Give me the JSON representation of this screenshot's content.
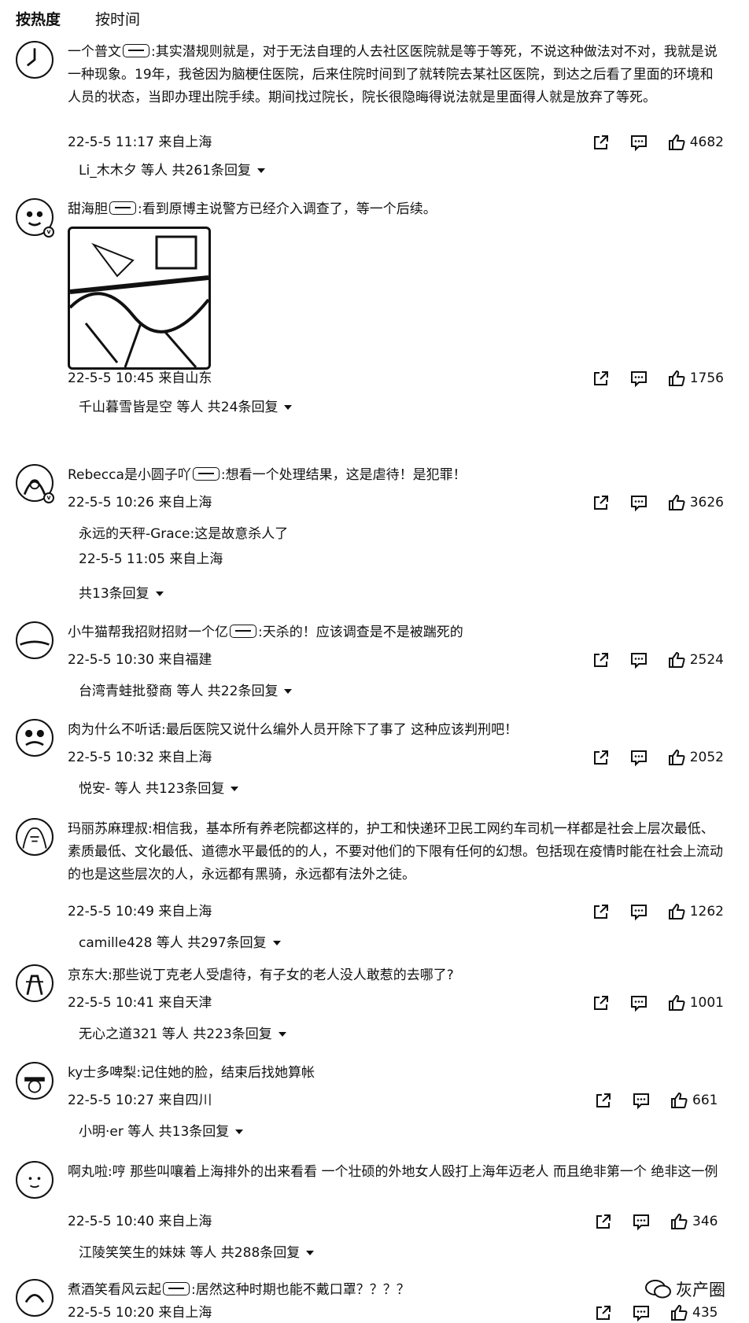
{
  "tabs": [
    {
      "label": "按热度",
      "active": true
    },
    {
      "label": "按时间",
      "active": false
    }
  ],
  "comments": [
    {
      "username": "一个普文",
      "text": ":其实潜规则就是，对于无法自理的人去社区医院就是等于等死，不说这种做法对不对，我就是说一种现象。19年，我爸因为脑梗住医院，后来住院时间到了就转院去某社区医院，到达之后看了里面的环境和人员的状态，当即办理出院手续。期间找过院长，院长很隐晦得说法就是里面得人就是放弃了等死。",
      "time": "22-5-5 11:17 来自上海",
      "likes": "4682",
      "replies": "Li_木木夕 等人  共261条回复"
    },
    {
      "username": "甜海胆",
      "text": ":看到原博主说警方已经介入调查了，等一个后续。",
      "time": "22-5-5 10:45 来自山东",
      "likes": "1756",
      "replies": "千山暮雪皆是空 等人  共24条回复"
    },
    {
      "username": "Rebecca是小圆子吖",
      "text": ":想看一个处理结果，这是虐待！是犯罪！",
      "time": "22-5-5 10:26 来自上海",
      "likes": "3626",
      "subreply": {
        "text": "永远的天秤-Grace:这是故意杀人了",
        "time": "22-5-5 11:05 来自上海"
      },
      "replies": "共13条回复"
    },
    {
      "username": "小牛猫帮我招财招财一个亿",
      "text": ":天杀的！应该调查是不是被踹死的",
      "time": "22-5-5 10:30 来自福建",
      "likes": "2524",
      "replies": "台湾青蛙批發商 等人  共22条回复"
    },
    {
      "username": "肉为什么不听话",
      "text": ":最后医院又说什么编外人员开除下了事了 这种应该判刑吧！",
      "time": "22-5-5 10:32 来自上海",
      "likes": "2052",
      "replies": "悦安- 等人  共123条回复"
    },
    {
      "username": "玛丽苏麻理叔",
      "text": ":相信我，基本所有养老院都这样的，护工和快递环卫民工网约车司机一样都是社会上层次最低、素质最低、文化最低、道德水平最低的的人，不要对他们的下限有任何的幻想。包括现在疫情时能在社会上流动的也是这些层次的人，永远都有黑骑，永远都有法外之徒。",
      "time": "22-5-5 10:49 来自上海",
      "likes": "1262",
      "replies": "camille428 等人  共297条回复"
    },
    {
      "username": "京东大",
      "text": ":那些说丁克老人受虐待，有子女的老人没人敢惹的去哪了?",
      "time": "22-5-5 10:41 来自天津",
      "likes": "1001",
      "replies": "无心之道321 等人  共223条回复"
    },
    {
      "username": "ky士多啤梨",
      "text": ":记住她的脸，结束后找她算帐",
      "time": "22-5-5 10:27 来自四川",
      "likes": "661",
      "replies": "小明·er 等人  共13条回复"
    },
    {
      "username": "啊丸啦",
      "text": ":哼 那些叫嚷着上海排外的出来看看 一个壮硕的外地女人殴打上海年迈老人 而且绝非第一个 绝非这一例",
      "time": "22-5-5 10:40 来自上海",
      "likes": "346",
      "replies": "江陵笑笑生的妹妹 等人  共288条回复"
    },
    {
      "username": "煮酒笑看风云起",
      "text": ":居然这种时期也能不戴口罩？？？？",
      "time": "22-5-5 10:20 来自上海",
      "likes": "435"
    }
  ],
  "watermark": "灰产圈"
}
